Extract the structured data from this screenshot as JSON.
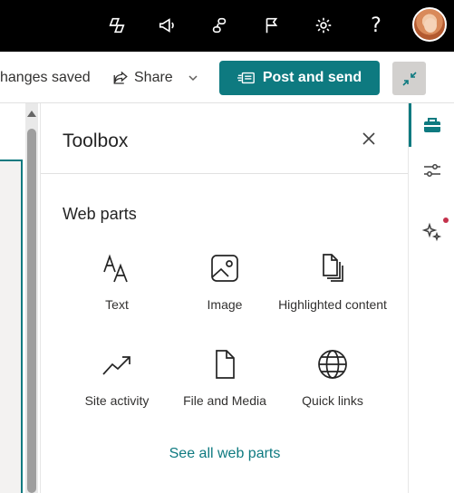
{
  "topbar": {
    "icons": [
      "copilot-icon",
      "megaphone-icon",
      "people-connect-icon",
      "flag-icon",
      "gear-icon",
      "help-icon"
    ],
    "help_label": "?",
    "avatar": "user-avatar"
  },
  "commandbar": {
    "saved_text": "hanges saved",
    "share_label": "Share",
    "post_label": "Post and send",
    "collapse_icon": "collapse-icon"
  },
  "toolbox": {
    "title": "Toolbox",
    "section": "Web parts",
    "items": [
      {
        "label": "Text",
        "icon": "text-icon"
      },
      {
        "label": "Image",
        "icon": "image-icon"
      },
      {
        "label": "Highlighted content",
        "icon": "highlighted-content-icon"
      },
      {
        "label": "Site activity",
        "icon": "trend-icon"
      },
      {
        "label": "File and Media",
        "icon": "document-icon"
      },
      {
        "label": "Quick links",
        "icon": "globe-icon"
      }
    ],
    "see_all": "See all web parts"
  },
  "rail": {
    "icons": [
      "toolbox-icon",
      "settings-sliders-icon",
      "design-ideas-icon"
    ]
  },
  "colors": {
    "accent": "#0e7a80",
    "topbar": "#000000",
    "notification_dot": "#c4314b"
  }
}
